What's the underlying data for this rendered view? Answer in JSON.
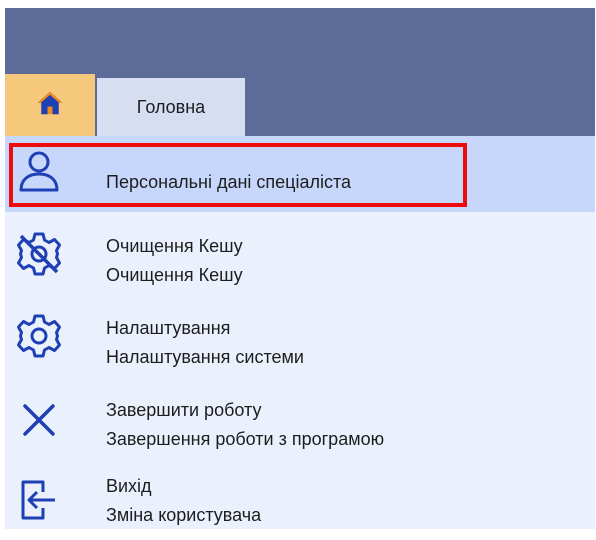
{
  "colors": {
    "titlebar": "#5c6b97",
    "home_tab": "#f5c87b",
    "main_tab": "#d7def2",
    "menu_bg": "#eaf1fd",
    "selected_bg": "#c7d7fb",
    "highlight_border": "#ee0b0b",
    "icon": "#1f3fb4"
  },
  "tabs": {
    "home_icon": "home-icon",
    "main_label": "Головна"
  },
  "menu": {
    "items": [
      {
        "icon": "user-icon",
        "title": "Персональні дані спеціаліста",
        "subtitle": ""
      },
      {
        "icon": "settings-off-icon",
        "title": "Очищення Кешу",
        "subtitle": "Очищення Кешу"
      },
      {
        "icon": "gear-icon",
        "title": "Налаштування",
        "subtitle": "Налаштування системи"
      },
      {
        "icon": "close-icon",
        "title": "Завершити роботу",
        "subtitle": "Завершення роботи з програмою"
      },
      {
        "icon": "logout-icon",
        "title": "Вихід",
        "subtitle": "Зміна користувача"
      }
    ]
  }
}
